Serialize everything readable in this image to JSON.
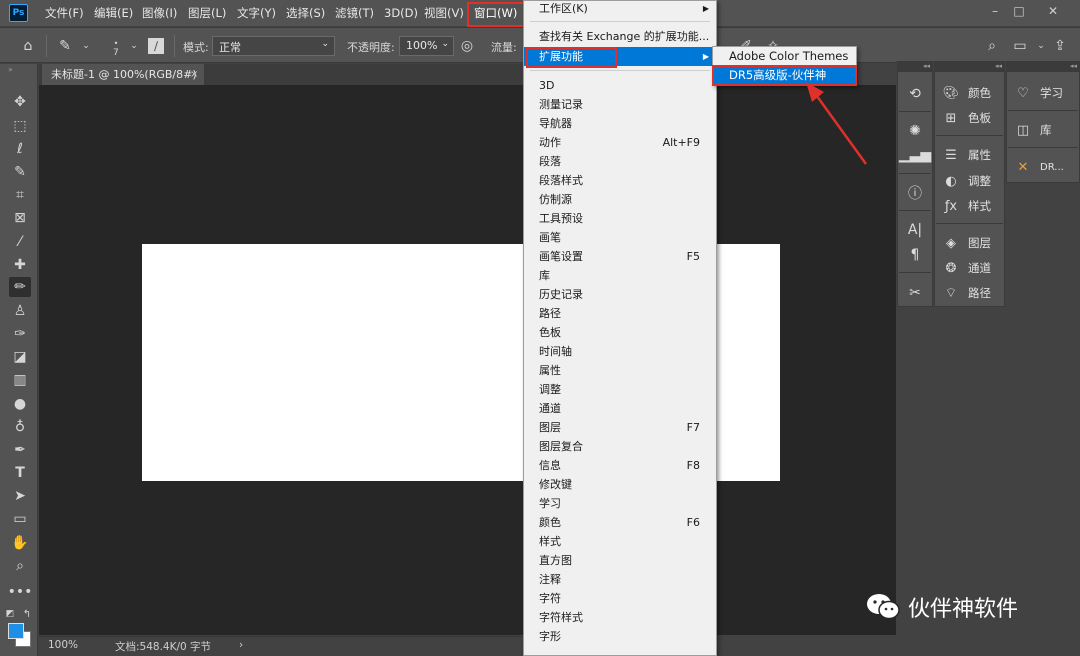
{
  "menubar": {
    "logo": "Ps",
    "items": [
      "文件(F)",
      "编辑(E)",
      "图像(I)",
      "图层(L)",
      "文字(Y)",
      "选择(S)",
      "滤镜(T)",
      "3D(D)",
      "视图(V)",
      "窗口(W)"
    ],
    "window_controls": [
      "–",
      "□",
      "✕"
    ]
  },
  "options": {
    "brush_size": "7",
    "mode_label": "模式:",
    "mode_value": "正常",
    "opacity_label": "不透明度:",
    "opacity_value": "100%",
    "flow_label": "流量:"
  },
  "document": {
    "tab_title": "未标题-1 @ 100%(RGB/8#)",
    "tab_close": "×",
    "zoom": "100%",
    "doc_info": "文档:548.4K/0 字节",
    "status_arrow": "›"
  },
  "window_menu": {
    "workspace": "工作区(K)",
    "find_extensions": "查找有关 Exchange 的扩展功能...",
    "extensions": "扩展功能",
    "items": [
      {
        "label": "3D",
        "shortcut": ""
      },
      {
        "label": "测量记录",
        "shortcut": ""
      },
      {
        "label": "导航器",
        "shortcut": ""
      },
      {
        "label": "动作",
        "shortcut": "Alt+F9"
      },
      {
        "label": "段落",
        "shortcut": ""
      },
      {
        "label": "段落样式",
        "shortcut": ""
      },
      {
        "label": "仿制源",
        "shortcut": ""
      },
      {
        "label": "工具预设",
        "shortcut": ""
      },
      {
        "label": "画笔",
        "shortcut": ""
      },
      {
        "label": "画笔设置",
        "shortcut": "F5"
      },
      {
        "label": "库",
        "shortcut": ""
      },
      {
        "label": "历史记录",
        "shortcut": ""
      },
      {
        "label": "路径",
        "shortcut": ""
      },
      {
        "label": "色板",
        "shortcut": ""
      },
      {
        "label": "时间轴",
        "shortcut": ""
      },
      {
        "label": "属性",
        "shortcut": ""
      },
      {
        "label": "调整",
        "shortcut": ""
      },
      {
        "label": "通道",
        "shortcut": ""
      },
      {
        "label": "图层",
        "shortcut": "F7"
      },
      {
        "label": "图层复合",
        "shortcut": ""
      },
      {
        "label": "信息",
        "shortcut": "F8"
      },
      {
        "label": "修改键",
        "shortcut": ""
      },
      {
        "label": "学习",
        "shortcut": ""
      },
      {
        "label": "颜色",
        "shortcut": "F6"
      },
      {
        "label": "样式",
        "shortcut": ""
      },
      {
        "label": "直方图",
        "shortcut": ""
      },
      {
        "label": "注释",
        "shortcut": ""
      },
      {
        "label": "字符",
        "shortcut": ""
      },
      {
        "label": "字符样式",
        "shortcut": ""
      },
      {
        "label": "字形",
        "shortcut": ""
      }
    ]
  },
  "extensions_submenu": {
    "items": [
      "Adobe Color Themes",
      "DR5高级版-伙伴神"
    ]
  },
  "panels": {
    "col1": [
      "颜色",
      "色板",
      "属性",
      "调整",
      "样式",
      "图层",
      "通道",
      "路径"
    ],
    "col2": [
      "学习",
      "库",
      "DR..."
    ]
  },
  "watermark": "伙伴神软件",
  "colors": {
    "highlight": "#0078d7",
    "annotation_red": "#e0302a",
    "foreground": "#1e90e6",
    "background": "#ffffff"
  }
}
